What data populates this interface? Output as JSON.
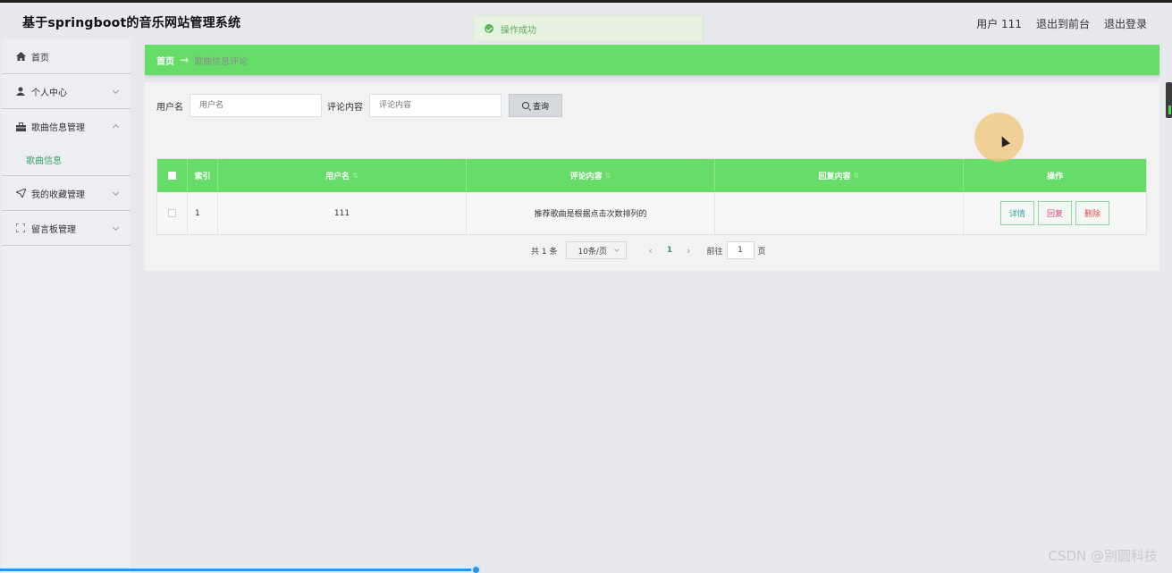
{
  "header": {
    "app_title": "基于springboot的音乐网站管理系统",
    "user_label": "用户 111",
    "back_front": "退出到前台",
    "logout": "退出登录"
  },
  "toast": {
    "message": "操作成功",
    "icon": "check-circle-icon",
    "color": "#61a85a"
  },
  "sidebar": {
    "items": [
      {
        "label": "首页",
        "icon": "home-icon"
      },
      {
        "label": "个人中心",
        "icon": "user-icon"
      },
      {
        "label": "歌曲信息管理",
        "icon": "briefcase-icon",
        "expanded": true
      },
      {
        "label": "歌曲信息",
        "icon": ""
      },
      {
        "label": "我的收藏管理",
        "icon": "send-icon"
      },
      {
        "label": "留言板管理",
        "icon": "frame-icon"
      }
    ]
  },
  "breadcrumb": {
    "home": "首页",
    "current": "歌曲信息评论"
  },
  "search": {
    "username_label": "用户名",
    "username_placeholder": "用户名",
    "comment_label": "评论内容",
    "comment_placeholder": "评论内容",
    "button": "查询"
  },
  "table": {
    "headers": {
      "index": "索引",
      "username": "用户名",
      "comment": "评论内容",
      "reply": "回复内容",
      "actions": "操作"
    },
    "rows": [
      {
        "index": "1",
        "username": "111",
        "comment": "推荐歌曲是根据点击次数排列的",
        "reply": ""
      }
    ],
    "row_actions": {
      "detail": "详情",
      "reply": "回复",
      "delete": "删除"
    }
  },
  "pagination": {
    "total": "共 1 条",
    "page_size": "10条/页",
    "current_page": "1",
    "goto_label": "前往",
    "goto_value": "1",
    "page_suffix": "页"
  },
  "watermark": "CSDN @别圆科技",
  "colors": {
    "accent_green": "#66dd69",
    "progress_blue": "#2b93e8"
  }
}
